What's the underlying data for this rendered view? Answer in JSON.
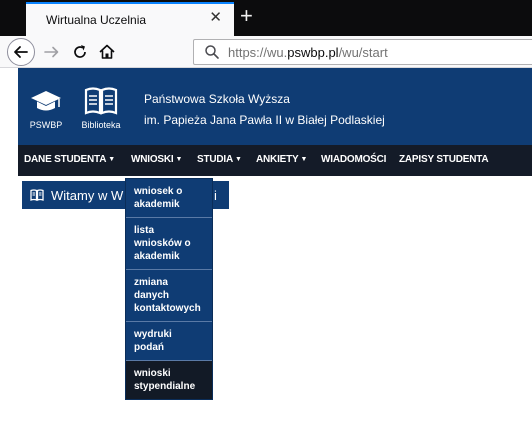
{
  "browser": {
    "tab_title": "Wirtualna Uczelnia",
    "tab_close": "✕",
    "new_tab": "+",
    "url_prefix": "https://wu.",
    "url_host": "pswbp.pl",
    "url_path": "/wu/start"
  },
  "header": {
    "logo_label": "PSWBP",
    "library_label": "Biblioteka",
    "school_line1": "Państwowa Szkoła Wyższa",
    "school_line2": "im. Papieża Jana Pawła II w Białej Podlaskiej"
  },
  "nav": {
    "items": [
      {
        "label": "DANE STUDENTA",
        "has_caret": true
      },
      {
        "label": "WNIOSKI",
        "has_caret": true
      },
      {
        "label": "STUDIA",
        "has_caret": true
      },
      {
        "label": "ANKIETY",
        "has_caret": true
      },
      {
        "label": "WIADOMOŚCI",
        "has_caret": false
      },
      {
        "label": "ZAPISY STUDENTA",
        "has_caret": false
      }
    ],
    "caret": "▼"
  },
  "welcome": {
    "text": "Witamy w W",
    "text_tail": "i"
  },
  "dropdown": {
    "items": [
      {
        "label": "wniosek o akademik"
      },
      {
        "label": "lista wniosków o akademik"
      },
      {
        "label": "zmiana danych kontaktowych"
      },
      {
        "label": "wydruki podań"
      },
      {
        "label": "wnioski stypendialne"
      }
    ]
  },
  "colors": {
    "header_blue": "#0f3c74",
    "navbar_dark": "#141b28",
    "dropdown_hover": "#121a26"
  }
}
